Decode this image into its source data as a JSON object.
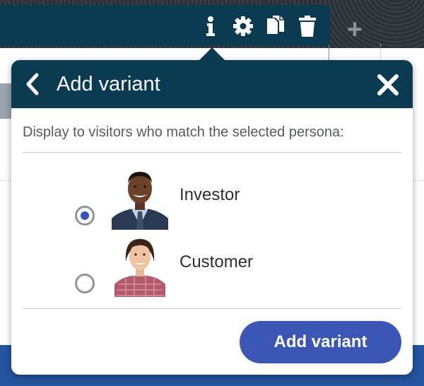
{
  "toolbar": {
    "icons": [
      "info-icon",
      "gear-icon",
      "copy-icon",
      "trash-icon"
    ]
  },
  "background": {
    "add_icon": "plus-icon",
    "plus_glyph": "+"
  },
  "popover": {
    "title": "Add variant",
    "back_icon": "chevron-left-icon",
    "close_icon": "close-icon",
    "description": "Display to visitors who match the selected persona:",
    "personas": [
      {
        "name": "Investor",
        "selected": true,
        "avatar": "investor-avatar"
      },
      {
        "name": "Customer",
        "selected": false,
        "avatar": "customer-avatar"
      }
    ],
    "submit_label": "Add variant"
  },
  "colors": {
    "header_bg": "#0b3b51",
    "accent": "#3b56b4",
    "page_bottom": "#2555a1"
  }
}
